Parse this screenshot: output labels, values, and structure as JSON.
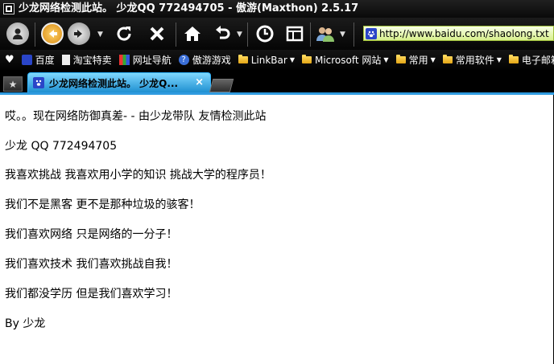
{
  "window": {
    "title": "少龙网络检测此站。 少龙QQ 772494705 - 傲游(Maxthon) 2.5.17"
  },
  "toolbar": {
    "address": "http://www.baidu.com/shaolong.txt",
    "icons": [
      "user-icon",
      "back-icon",
      "forward-icon",
      "history-dropdown-icon",
      "refresh-icon",
      "stop-icon",
      "home-icon",
      "undo-icon",
      "clock-icon",
      "layout-icon",
      "users-icon"
    ]
  },
  "bookmarks": {
    "items": [
      {
        "label": "百度"
      },
      {
        "label": "淘宝特卖"
      },
      {
        "label": "网址导航"
      },
      {
        "label": "傲游游戏"
      },
      {
        "label": "LinkBar"
      },
      {
        "label": "Microsoft 网站"
      },
      {
        "label": "常用"
      },
      {
        "label": "常用软件"
      },
      {
        "label": "电子邮箱"
      }
    ]
  },
  "tabs": {
    "active": {
      "label": "少龙网络检测此站。 少龙Q...",
      "close": "×"
    }
  },
  "content": {
    "lines": [
      "哎。。现在网络防御真差- - 由少龙带队 友情检测此站",
      "少龙 QQ 772494705",
      "我喜欢挑战 我喜欢用小学的知识 挑战大学的程序员！",
      "我们不是黑客 更不是那种垃圾的骇客！",
      "我们喜欢网络 只是网络的一分子！",
      "我们喜欢技术 我们喜欢挑战自我！",
      "我们都没学历 但是我们喜欢学习！",
      "By 少龙"
    ]
  },
  "colors": {
    "tab_active": "#1f8fd0",
    "address_bg": "#d8f08c",
    "accent": "#2f9be0"
  }
}
